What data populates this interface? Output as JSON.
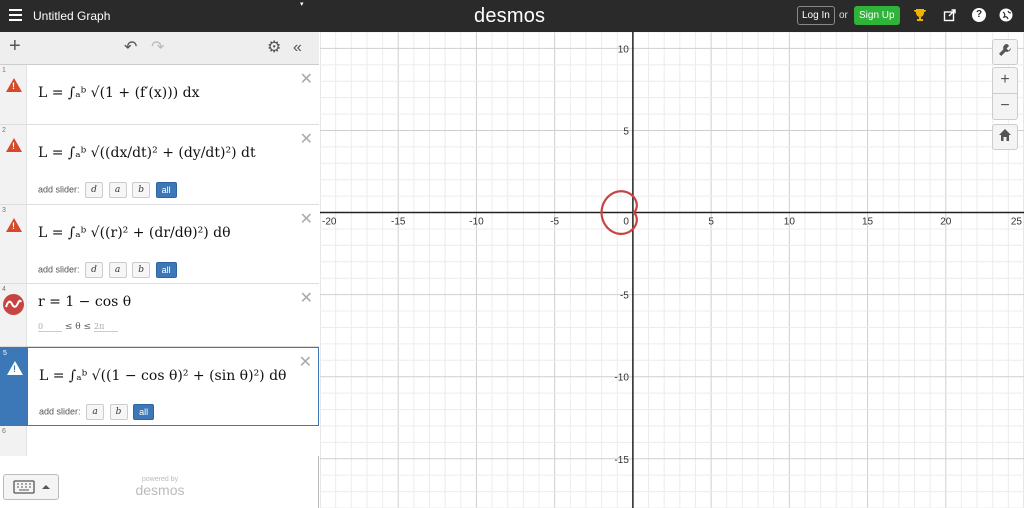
{
  "header": {
    "title": "Untitled Graph",
    "logo": "desmos",
    "login_label": "Log In",
    "or_label": "or",
    "signup_label": "Sign Up",
    "icons": [
      "menu-icon",
      "trophy-icon",
      "share-icon",
      "help-icon",
      "globe-icon"
    ],
    "accent_signup": "#2fb33b"
  },
  "toolbar": {
    "icons": [
      "plus-icon",
      "undo-icon",
      "redo-icon",
      "settings-icon",
      "collapse-icon"
    ]
  },
  "expressions": [
    {
      "num": "1",
      "latex": "L = ∫ₐᵇ √(1 + (f′(x))) dx",
      "status": "warning"
    },
    {
      "num": "2",
      "latex": "L = ∫ₐᵇ √((dx/dt)² + (dy/dt)²) dt",
      "status": "warning",
      "slider_label": "add slider:",
      "sliders": [
        "d",
        "a",
        "b",
        "all"
      ]
    },
    {
      "num": "3",
      "latex": "L = ∫ₐᵇ √((r)² + (dr/dθ)²) dθ",
      "status": "warning",
      "slider_label": "add slider:",
      "sliders": [
        "d",
        "a",
        "b",
        "all"
      ]
    },
    {
      "num": "4",
      "latex": "r = 1 − cos θ",
      "status": "graphed",
      "color": "#c74440",
      "domain_min": "0",
      "domain_mid": "≤ θ ≤",
      "domain_max": "2π"
    },
    {
      "num": "5",
      "latex": "L = ∫ₐᵇ √((1 − cos θ)² + (sin θ)²) dθ",
      "status": "warning",
      "active": true,
      "slider_label": "add slider:",
      "sliders": [
        "a",
        "b",
        "all"
      ]
    },
    {
      "num": "6",
      "latex": ""
    }
  ],
  "footer": {
    "powered_by": "powered by",
    "brand": "desmos"
  },
  "graph": {
    "x_range": [
      -20,
      25
    ],
    "y_range": [
      -18,
      11
    ],
    "x_ticks": [
      "-20",
      "-15",
      "-10",
      "-5",
      "0",
      "5",
      "10",
      "15",
      "20",
      "25"
    ],
    "y_ticks": [
      "10",
      "5",
      "-5",
      "-10",
      "-15"
    ],
    "grid": true,
    "curve_color": "#c74440",
    "zoom_controls": [
      "wrench-icon",
      "zoom-in-icon",
      "zoom-out-icon",
      "home-icon"
    ]
  }
}
